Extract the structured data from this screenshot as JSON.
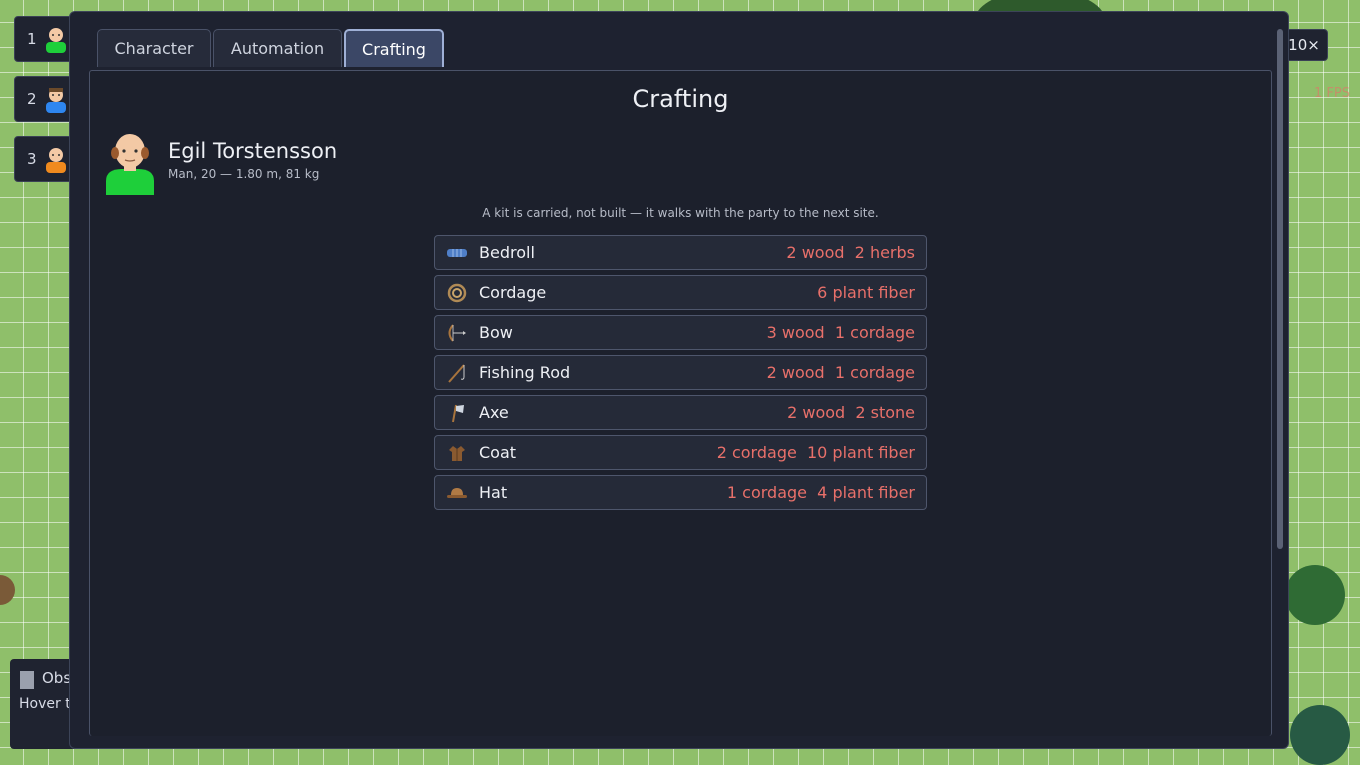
{
  "hud": {
    "party": [
      {
        "index": "1",
        "shirt_color": "#1ecf3a"
      },
      {
        "index": "2",
        "shirt_color": "#2e86f0"
      },
      {
        "index": "3",
        "shirt_color": "#f08a1e"
      }
    ],
    "speed_label": "10×",
    "fps_label": "1 FPS",
    "obs_panel": {
      "title": "Obs",
      "hint": "Hover t"
    }
  },
  "tabs": [
    {
      "label": "Character"
    },
    {
      "label": "Automation"
    },
    {
      "label": "Crafting",
      "active": true
    }
  ],
  "panel": {
    "title": "Crafting",
    "character": {
      "name": "Egil Torstensson",
      "details": "Man, 20 — 1.80 m, 81 kg",
      "shirt_color": "#1ecf3a"
    },
    "note": "A kit is carried, not built — it walks with the party to the next site.",
    "recipes": [
      {
        "name": "Bedroll",
        "icon": "bedroll-icon",
        "cost": "2 wood  2 herbs"
      },
      {
        "name": "Cordage",
        "icon": "rope-coil-icon",
        "cost": "6 plant fiber"
      },
      {
        "name": "Bow",
        "icon": "bow-icon",
        "cost": "3 wood  1 cordage"
      },
      {
        "name": "Fishing Rod",
        "icon": "fishing-rod-icon",
        "cost": "2 wood  1 cordage"
      },
      {
        "name": "Axe",
        "icon": "axe-icon",
        "cost": "2 wood  2 stone"
      },
      {
        "name": "Coat",
        "icon": "coat-icon",
        "cost": "2 cordage  10 plant fiber"
      },
      {
        "name": "Hat",
        "icon": "hat-icon",
        "cost": "1 cordage  4 plant fiber"
      }
    ]
  },
  "colors": {
    "cost_red": "#e8706a",
    "active_tab": "#3b4766"
  }
}
